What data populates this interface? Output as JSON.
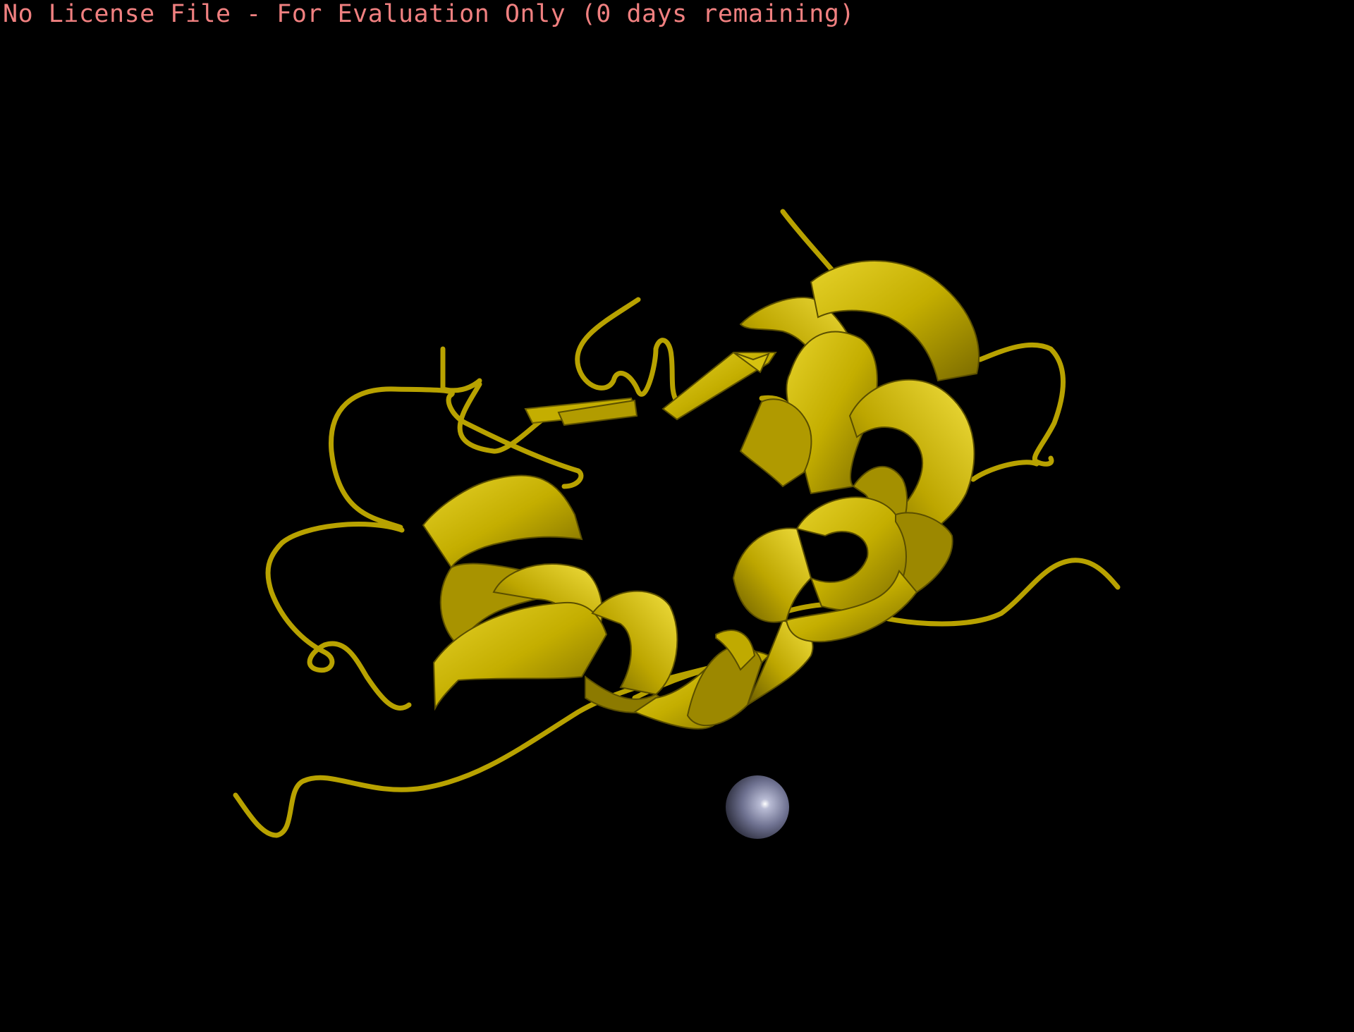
{
  "viewer": {
    "license_banner": "No License File - For Evaluation Only (0 days remaining)",
    "banner_color": "#f08080",
    "background_color": "#000000"
  },
  "scene": {
    "representation": "cartoon",
    "ribbon_color": "#c8b400",
    "ion": {
      "representation": "sphere",
      "color": "#6c6f8c"
    }
  }
}
